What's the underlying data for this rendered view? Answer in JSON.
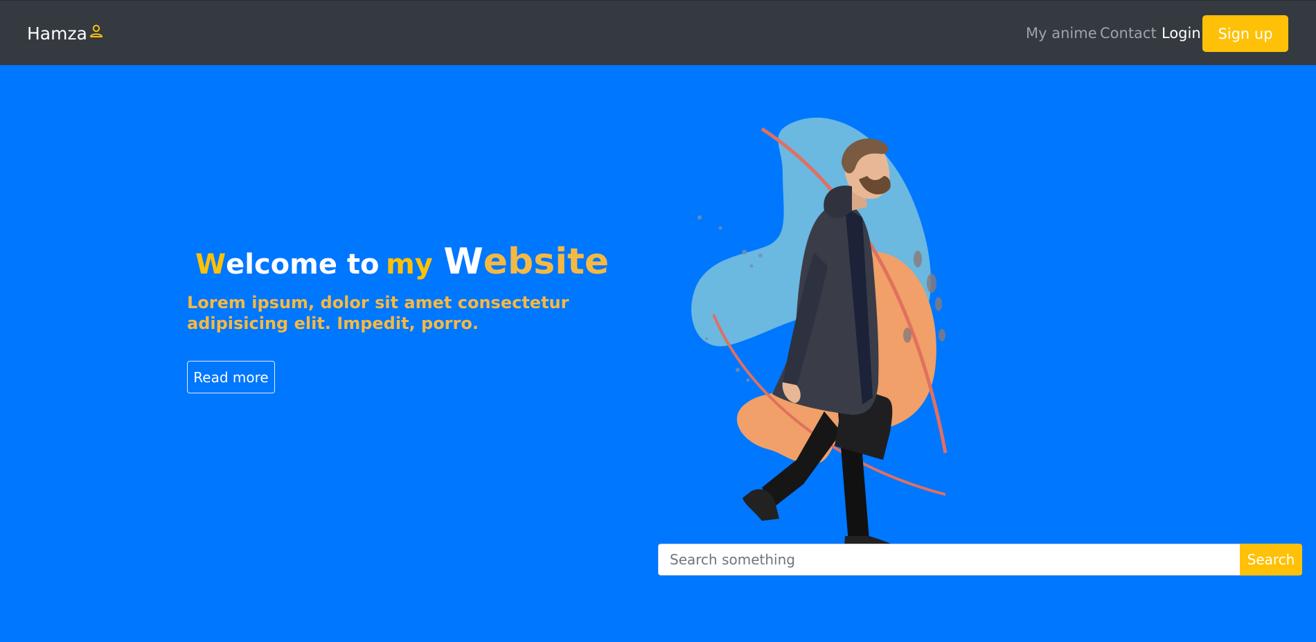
{
  "navbar": {
    "brand": "Hamza",
    "brand_icon": "user-icon",
    "links": {
      "my_anime": "My anime",
      "contact": "Contact",
      "login": "Login"
    },
    "signup_label": "Sign up"
  },
  "hero": {
    "title": {
      "w1": "W",
      "w1_rest": "elcome to",
      "my": "my",
      "w2": "W",
      "w2_rest": "ebsite"
    },
    "subtitle": "Lorem ipsum, dolor sit amet consectetur adipisicing elit. Impedit, porro.",
    "read_more_label": "Read more",
    "illustration": "man-walking-illustration"
  },
  "search": {
    "placeholder": "Search something",
    "button_label": "Search"
  },
  "colors": {
    "navbar_bg": "#343a40",
    "hero_bg": "#0077ff",
    "accent": "#ffc107",
    "subtitle": "#f5b942"
  }
}
